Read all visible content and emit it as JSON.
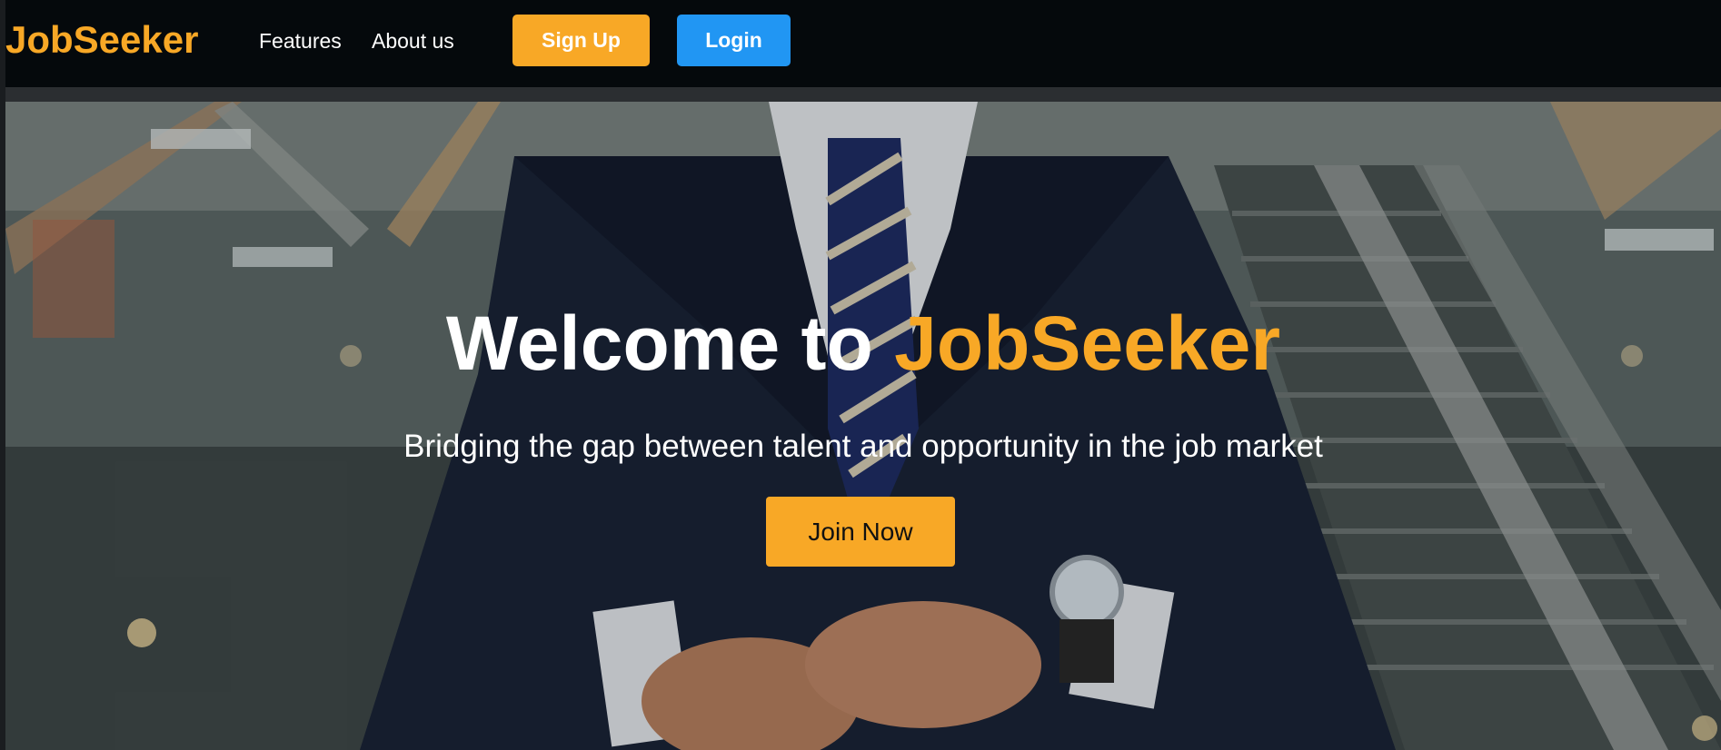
{
  "navbar": {
    "brand": "JobSeeker",
    "links": [
      {
        "label": "Features"
      },
      {
        "label": "About us"
      }
    ],
    "signup_label": "Sign Up",
    "login_label": "Login"
  },
  "hero": {
    "title_prefix": "Welcome to ",
    "title_brand": "JobSeeker",
    "subtitle": "Bridging the gap between talent and opportunity in the job market",
    "cta_label": "Join Now"
  },
  "colors": {
    "brand_orange": "#f8a826",
    "login_blue": "#2196f3",
    "navbar_bg": "#05090c"
  }
}
